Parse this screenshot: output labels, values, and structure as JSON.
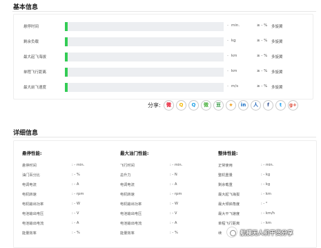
{
  "basic": {
    "title": "基本信息",
    "stats": [
      {
        "label": "悬停时间",
        "fill": 0.017,
        "dash": "-",
        "unit": "min.",
        "ge": "≥ - %",
        "type": "多旋翼"
      },
      {
        "label": "剩余负载",
        "fill": 0.017,
        "dash": "-",
        "unit": "kg",
        "ge": "≥ - %",
        "type": "多旋翼"
      },
      {
        "label": "最大起飞海拔",
        "fill": 0.017,
        "dash": "-",
        "unit": "km",
        "ge": "≥ - %",
        "type": "多旋翼"
      },
      {
        "label": "单程飞行距离",
        "fill": 0.017,
        "dash": "-",
        "unit": "km",
        "ge": "≥ - %",
        "type": "多旋翼"
      },
      {
        "label": "最大前飞速度",
        "fill": 0.017,
        "dash": "-",
        "unit": "m/s",
        "ge": "≥ - %",
        "type": "多旋翼"
      }
    ],
    "bar_color": "#33cc55"
  },
  "share": {
    "label": "分享:",
    "icons": [
      {
        "name": "weibo-icon",
        "glyph": "微",
        "color": "#e6162d"
      },
      {
        "name": "qzone-icon",
        "glyph": "Q",
        "color": "#f5b800"
      },
      {
        "name": "qq-icon",
        "glyph": "Q",
        "color": "#1ea0e6"
      },
      {
        "name": "wechat-icon",
        "glyph": "微",
        "color": "#4cb140"
      },
      {
        "name": "douban-icon",
        "glyph": "豆",
        "color": "#2e963d"
      },
      {
        "name": "favorite-star-icon",
        "glyph": "★",
        "color": "#f0a020"
      },
      {
        "name": "linkedin-icon",
        "glyph": "in",
        "color": "#0a66c2"
      },
      {
        "name": "renren-icon",
        "glyph": "人",
        "color": "#2266bb"
      },
      {
        "name": "facebook-icon",
        "glyph": "f",
        "color": "#3b5998"
      },
      {
        "name": "twitter-icon",
        "glyph": "t",
        "color": "#1da1f2"
      },
      {
        "name": "googleplus-icon",
        "glyph": "g+",
        "color": "#dd4b39"
      }
    ]
  },
  "detail": {
    "title": "详细信息",
    "columns": [
      {
        "title": "悬停性能:",
        "rows": [
          {
            "label": "悬停时间",
            "value": ": - min."
          },
          {
            "label": "油门百分比",
            "value": ": - %"
          },
          {
            "label": "电调电流",
            "value": ": - A"
          },
          {
            "label": "电机转速",
            "value": ": - rpm"
          },
          {
            "label": "电机输出功率",
            "value": ": - W"
          },
          {
            "label": "电池输出电压",
            "value": ": - V"
          },
          {
            "label": "电池输出电流",
            "value": ": - A"
          },
          {
            "label": "能量效率",
            "value": ": - %"
          }
        ]
      },
      {
        "title": "最大油门性能:",
        "rows": [
          {
            "label": "飞行时间",
            "value": ": - min."
          },
          {
            "label": "总升力",
            "value": ": - N"
          },
          {
            "label": "电调电流",
            "value": ": - A"
          },
          {
            "label": "电机转速",
            "value": ": - rpm"
          },
          {
            "label": "电机输出功率",
            "value": ": - W"
          },
          {
            "label": "电池输出电压",
            "value": ": - V"
          },
          {
            "label": "电池输出电流",
            "value": ": - A"
          },
          {
            "label": "能量效率",
            "value": ": - %"
          }
        ]
      },
      {
        "title": "整体性能:",
        "rows": [
          {
            "label": "正常使用",
            "value": ": - min."
          },
          {
            "label": "整机重量",
            "value": ": - kg"
          },
          {
            "label": "剩余载重",
            "value": ": - kg"
          },
          {
            "label": "最大起飞海拔",
            "value": ": - km"
          },
          {
            "label": "最大倾斜角度",
            "value": ": - °"
          },
          {
            "label": "最大平飞速度",
            "value": ": - km/h"
          },
          {
            "label": "单程飞行距离",
            "value": ": - km"
          },
          {
            "label": "续",
            "value": ""
          }
        ]
      }
    ]
  },
  "watermark": {
    "text": "航模无人机干货分享"
  }
}
